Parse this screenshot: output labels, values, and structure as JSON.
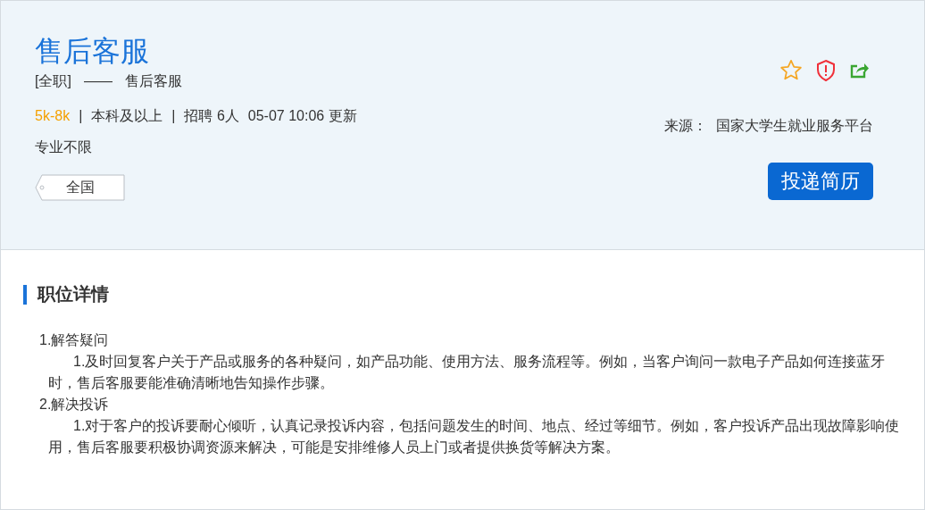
{
  "job": {
    "title": "售后客服",
    "type_line": [
      "[全职]",
      "——",
      "售后客服"
    ],
    "meta": [
      {
        "kind": "salary",
        "text": "5k-8k"
      },
      {
        "kind": "sep",
        "text": "|"
      },
      {
        "kind": "text",
        "text": "本科及以上"
      },
      {
        "kind": "sep",
        "text": "|"
      },
      {
        "kind": "text",
        "text": "招聘 6人"
      },
      {
        "kind": "text",
        "text": "05-07 10:06 更新"
      }
    ],
    "major": "专业不限",
    "location_tag": "全国",
    "source_label": "来源：",
    "source": "国家大学生就业服务平台",
    "apply_button": "投递简历"
  },
  "details": {
    "heading": "职位详情",
    "paragraphs": [
      {
        "kind": "heading",
        "text": "1.解答疑问"
      },
      {
        "kind": "body",
        "text": "1.及时回复客户关于产品或服务的各种疑问，如产品功能、使用方法、服务流程等。例如，当客户询问一款电子产品如何连接蓝牙时，售后客服要能准确清晰地告知操作步骤。"
      },
      {
        "kind": "heading",
        "text": "2.解决投诉"
      },
      {
        "kind": "body",
        "text": "1.对于客户的投诉要耐心倾听，认真记录投诉内容，包括问题发生的时间、地点、经过等细节。例如，客户投诉产品出现故障影响使用，售后客服要积极协调资源来解决，可能是安排维修人员上门或者提供换货等解决方案。"
      }
    ]
  }
}
